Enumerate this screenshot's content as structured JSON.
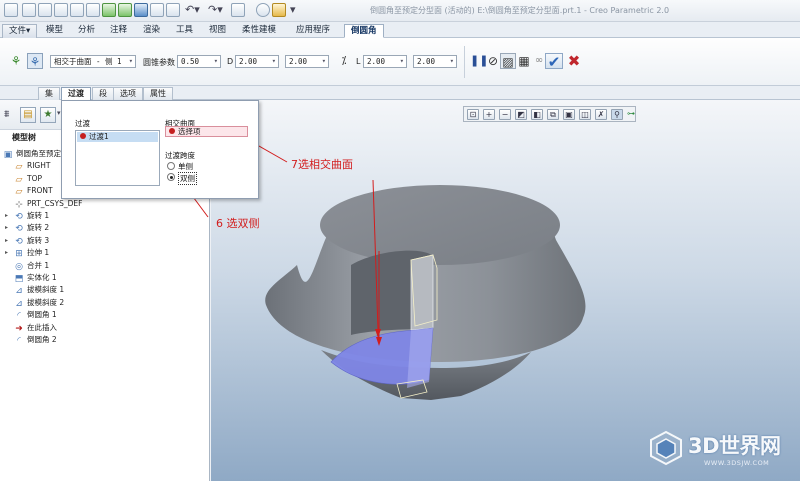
{
  "window": {
    "title": "倒圆角至预定分型面 (活动的) E:\\倒圆角至预定分型面.prt.1 - Creo Parametric 2.0"
  },
  "ribbon_tabs": [
    {
      "label": "文件▾",
      "active": false
    },
    {
      "label": "模型",
      "active": false
    },
    {
      "label": "分析",
      "active": false
    },
    {
      "label": "注释",
      "active": false
    },
    {
      "label": "渲染",
      "active": false
    },
    {
      "label": "工具",
      "active": false
    },
    {
      "label": "视图",
      "active": false
    },
    {
      "label": "柔性建模",
      "active": false
    },
    {
      "label": "应用程序",
      "active": false
    },
    {
      "label": "倒圆角",
      "active": true
    }
  ],
  "dashboard": {
    "type_combo": "相交于曲面 - 侧 1",
    "cone_param_label": "圆锥参数",
    "cone_param_value": "0.50",
    "d_label": "D",
    "d_value": "2.00",
    "d2_value": "2.00",
    "l_label": "L",
    "l_value": "2.00",
    "l2_value": "2.00"
  },
  "sub_tabs": [
    {
      "label": "集",
      "active": false
    },
    {
      "label": "过渡",
      "active": true
    },
    {
      "label": "段",
      "active": false
    },
    {
      "label": "选项",
      "active": false
    },
    {
      "label": "属性",
      "active": false
    }
  ],
  "model_tree": {
    "header": "模型树",
    "items": [
      {
        "label": "倒圆角至预定",
        "icon": "part-icon"
      },
      {
        "label": "RIGHT",
        "icon": "datum-plane-icon"
      },
      {
        "label": "TOP",
        "icon": "datum-plane-icon"
      },
      {
        "label": "FRONT",
        "icon": "datum-plane-icon"
      },
      {
        "label": "PRT_CSYS_DEF",
        "icon": "csys-icon"
      },
      {
        "label": "旋转 1",
        "icon": "revolve-icon"
      },
      {
        "label": "旋转 2",
        "icon": "revolve-icon"
      },
      {
        "label": "旋转 3",
        "icon": "revolve-icon"
      },
      {
        "label": "拉伸 1",
        "icon": "extrude-icon"
      },
      {
        "label": "合并 1",
        "icon": "merge-icon"
      },
      {
        "label": "实体化 1",
        "icon": "solidify-icon"
      },
      {
        "label": "拔模斜度 1",
        "icon": "draft-icon"
      },
      {
        "label": "拔模斜度 2",
        "icon": "draft-icon"
      },
      {
        "label": "倒圆角 1",
        "icon": "round-icon"
      },
      {
        "label": "在此插入",
        "icon": "insert-here-arrow-icon"
      },
      {
        "label": "倒圆角 2",
        "icon": "round-icon"
      }
    ]
  },
  "popup": {
    "transitions_label": "过渡",
    "transition_item": "过渡1",
    "intersect_surface_label": "相交曲面",
    "surface_collector": "选择项",
    "transition_span_label": "过渡跨度",
    "single_side": "单侧",
    "two_sided": "双侧",
    "selected_span": "双侧"
  },
  "annotations": {
    "step6": "6 选双侧",
    "step7": "7选相交曲面"
  },
  "watermark": {
    "text": "3D世界网",
    "url": "WWW.3DSJW.COM"
  },
  "colors": {
    "annotation_red": "#d21d1d",
    "selected_surface": "#7f86e6",
    "model_gray": "#8b9097"
  }
}
